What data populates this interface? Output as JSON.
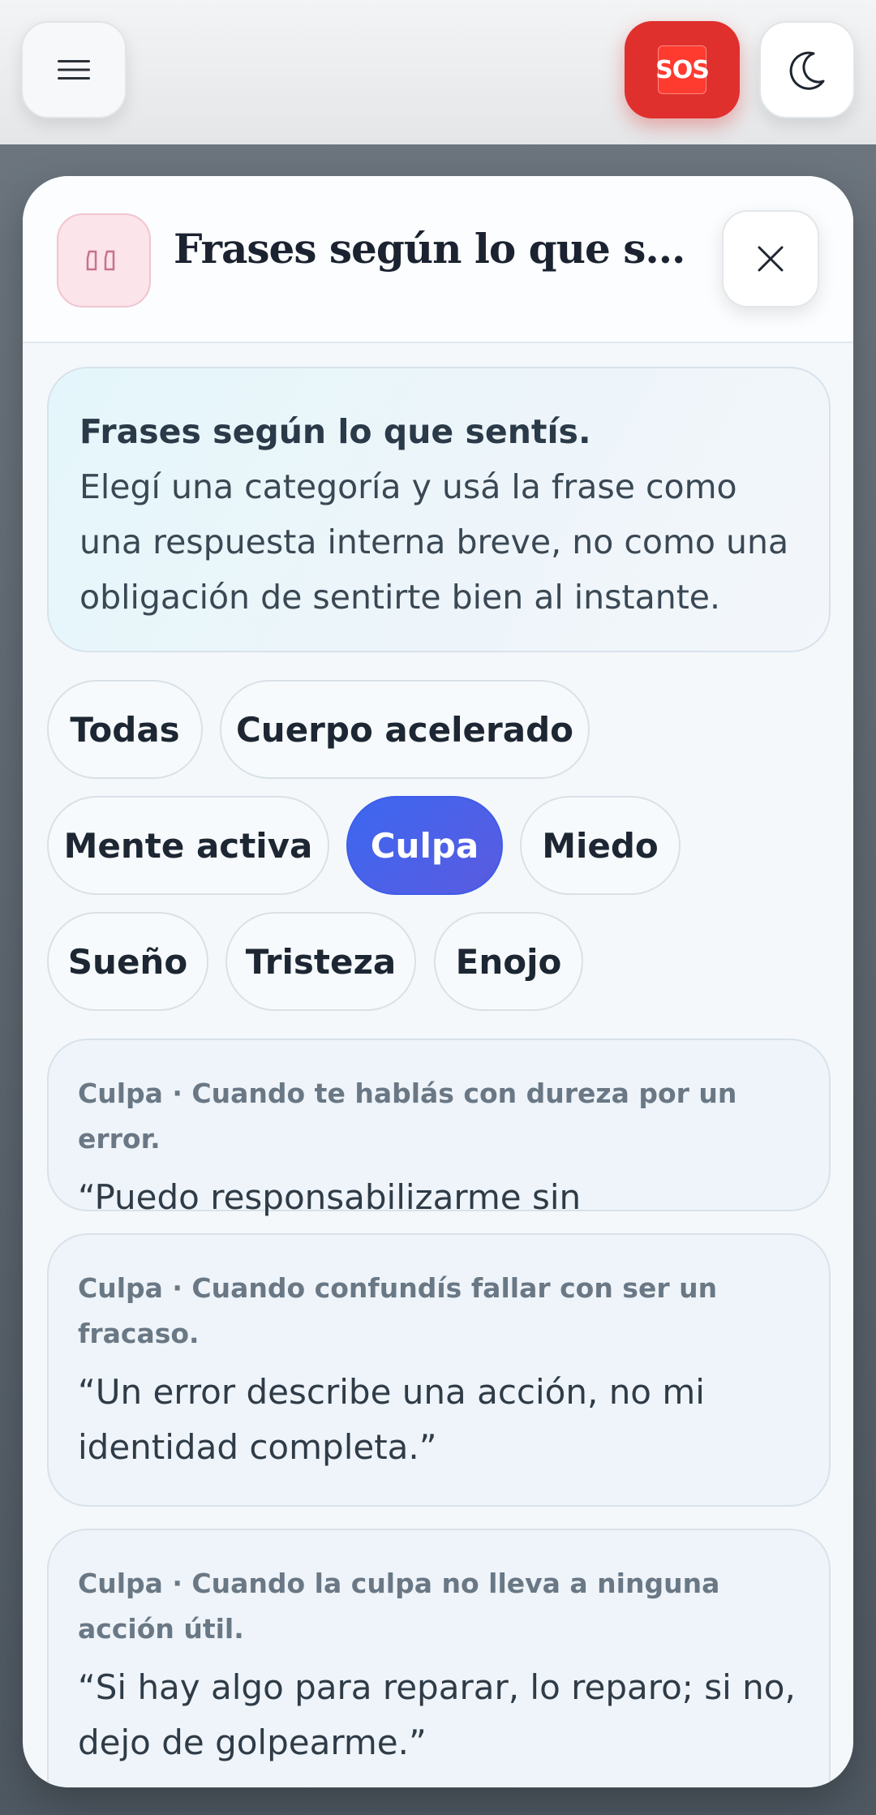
{
  "topbar": {
    "menu_icon": "hamburger-menu-icon",
    "sos_label": "SOS",
    "theme_icon": "moon-icon"
  },
  "modal": {
    "badge_icon": "quote-marks-icon",
    "title": "Frases según lo que se...",
    "close_icon": "close-icon"
  },
  "intro": {
    "title": "Frases según lo que sentís.",
    "body": "Elegí una categoría y usá la frase como una respuesta interna breve, no como una obligación de sentirte bien al instante."
  },
  "categories": [
    {
      "label": "Todas",
      "active": false
    },
    {
      "label": "Cuerpo acelerado",
      "active": false
    },
    {
      "label": "Mente activa",
      "active": false
    },
    {
      "label": "Culpa",
      "active": true
    },
    {
      "label": "Miedo",
      "active": false
    },
    {
      "label": "Sueño",
      "active": false
    },
    {
      "label": "Tristeza",
      "active": false
    },
    {
      "label": "Enojo",
      "active": false
    }
  ],
  "phrases": [
    {
      "meta": "Culpa · Cuando te hablás con dureza por un error.",
      "quote": "“Puedo responsabilizarme sin castigarme.”"
    },
    {
      "meta": "Culpa · Cuando confundís fallar con ser un fracaso.",
      "quote": "“Un error describe una acción, no mi identidad completa.”"
    },
    {
      "meta": "Culpa · Cuando la culpa no lleva a ninguna acción útil.",
      "quote": "“Si hay algo para reparar, lo reparo; si no, dejo de golpearme.”"
    }
  ],
  "colors": {
    "accent": "#3c67f0",
    "sos": "#e0302e",
    "badge_pink": "#fbe4ea"
  }
}
